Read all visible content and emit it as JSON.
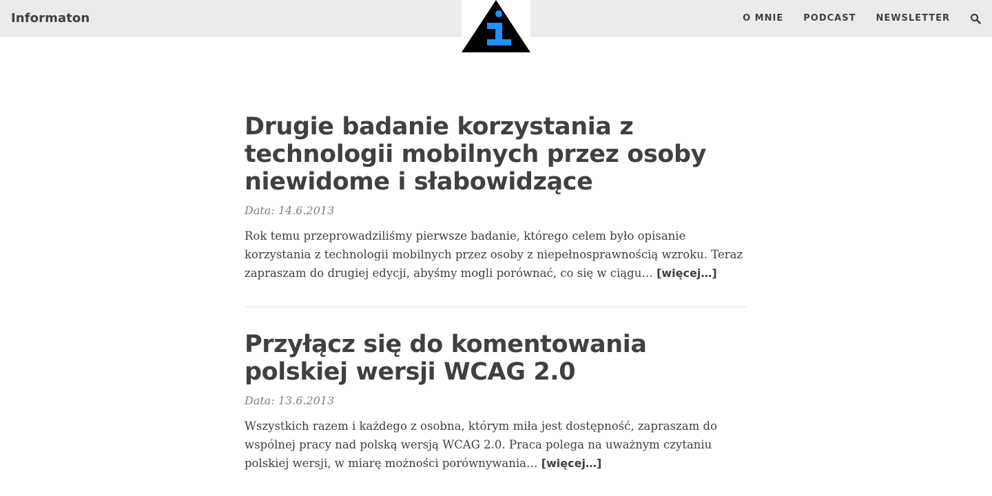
{
  "site": {
    "brand": "Informaton",
    "nav": [
      {
        "label": "O MNIE"
      },
      {
        "label": "PODCAST"
      },
      {
        "label": "NEWSLETTER"
      }
    ],
    "search_icon": "search-icon",
    "logo_icon": "info-triangle-logo-icon"
  },
  "colors": {
    "header_bg": "#ebebeb",
    "text": "#404040",
    "meta": "#808080",
    "logo_blue": "#1e90ff",
    "logo_black": "#000000"
  },
  "posts": [
    {
      "title": "Drugie badanie korzystania z technologii mobilnych przez osoby niewidome i słabowidzące",
      "date": "Data: 14.6.2013",
      "excerpt": "Rok temu przeprowadziliśmy pierwsze badanie, którego celem było opisanie korzystania z technologii mobilnych przez osoby z niepełnosprawnością wzroku. Teraz zapraszam do drugiej edycji, abyśmy mogli porównać, co się w ciągu… ",
      "more": "[więcej…]"
    },
    {
      "title": "Przyłącz się do komentowania polskiej wersji WCAG 2.0",
      "date": "Data: 13.6.2013",
      "excerpt": "Wszystkich razem i każdego z osobna, którym miła jest dostępność, zapraszam do wspólnej pracy nad polską wersją WCAG 2.0. Praca polega na uważnym czytaniu polskiej wersji, w miarę możności porównywania… ",
      "more": "[więcej…]"
    }
  ]
}
